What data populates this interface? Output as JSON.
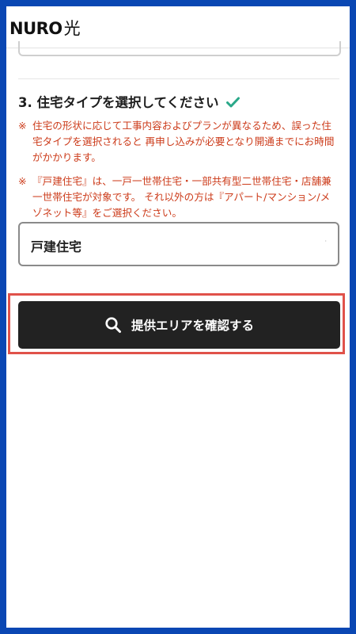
{
  "header": {
    "brand": "NURO",
    "brand_suffix": "光"
  },
  "section": {
    "title": "3. 住宅タイプを選択してください",
    "title_icon": "check-icon"
  },
  "notes": [
    {
      "mark": "※",
      "text": "住宅の形状に応じて工事内容およびプランが異なるため、誤った住宅タイプを選択されると 再申し込みが必要となり開通までにお時間がかかります。"
    },
    {
      "mark": "※",
      "text": "『戸建住宅』は、一戸一世帯住宅・一部共有型二世帯住宅・店舗兼一世帯住宅が対象です。 それ以外の方は『アパート/マンション/メゾネット等』をご選択ください。"
    }
  ],
  "housing_select": {
    "selected": "戸建住宅"
  },
  "confirm_button": {
    "label": "提供エリアを確認する",
    "icon": "search-icon"
  },
  "colors": {
    "frame": "#0a47b3",
    "note_text": "#cc3b1a",
    "check": "#2aa889",
    "button_bg": "#222222",
    "highlight": "#e0524a"
  }
}
